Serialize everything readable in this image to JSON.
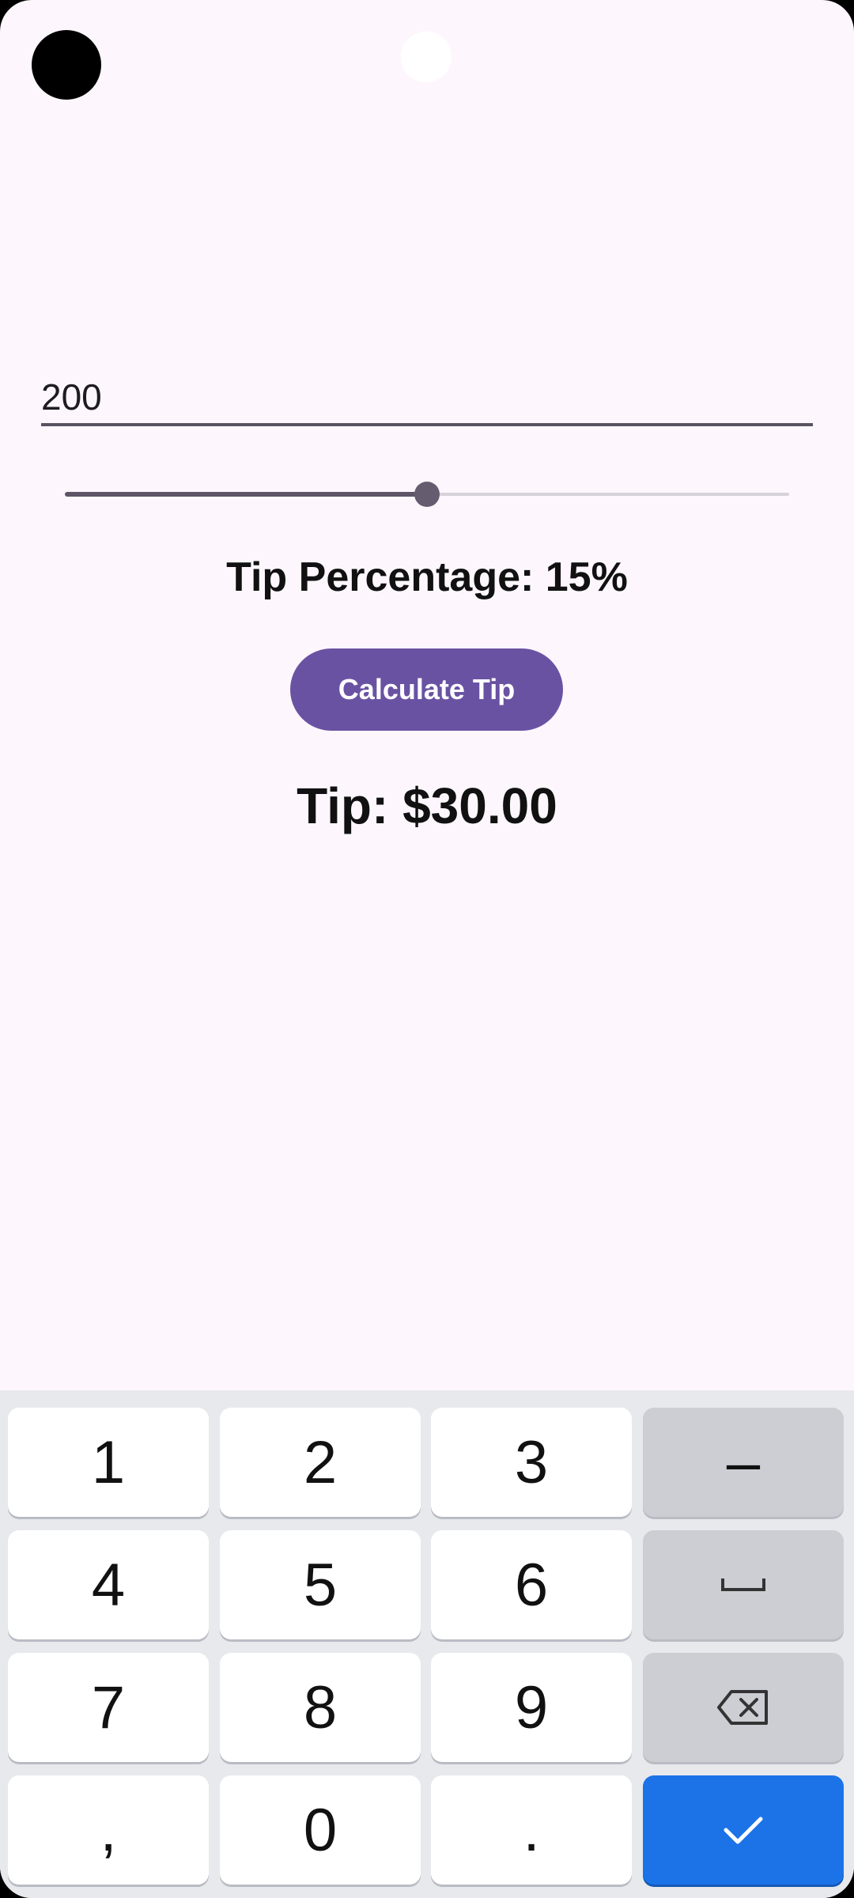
{
  "amount_input": {
    "value": "200"
  },
  "tip_slider": {
    "value_percent": 15,
    "fill_fraction": 0.5
  },
  "tip_percentage_label": "Tip Percentage: 15%",
  "calculate_button_label": "Calculate Tip",
  "tip_result_label": "Tip: $30.00",
  "keyboard": {
    "rows": [
      [
        "1",
        "2",
        "3",
        "–"
      ],
      [
        "4",
        "5",
        "6",
        "space-icon"
      ],
      [
        "7",
        "8",
        "9",
        "backspace-icon"
      ],
      [
        ",",
        "0",
        ".",
        "check-icon"
      ]
    ]
  },
  "colors": {
    "background": "#fdf7fd",
    "accent": "#6a52a3",
    "enter_key": "#1c73e8"
  }
}
